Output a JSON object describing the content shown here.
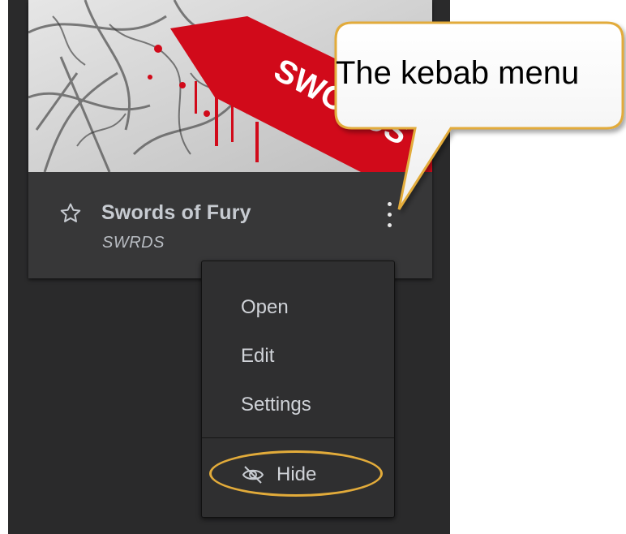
{
  "card": {
    "title": "Swords of Fury",
    "key": "SWRDS",
    "cover_art_text": "SWORDS OF FURY"
  },
  "menu": {
    "items": [
      {
        "label": "Open"
      },
      {
        "label": "Edit"
      },
      {
        "label": "Settings"
      }
    ],
    "hide_label": "Hide"
  },
  "annotation": {
    "callout_text": "The kebab menu",
    "highlight_color": "#e2ab3a"
  },
  "icons": {
    "favorite": "star-outline-icon",
    "more": "kebab-icon",
    "hide": "eye-slash-icon"
  },
  "colors": {
    "panel_bg": "#2a2a2b",
    "card_bg": "#373738",
    "menu_bg": "#2f2f30",
    "text_primary": "#c7cbd1",
    "accent_red": "#d10a1a"
  }
}
